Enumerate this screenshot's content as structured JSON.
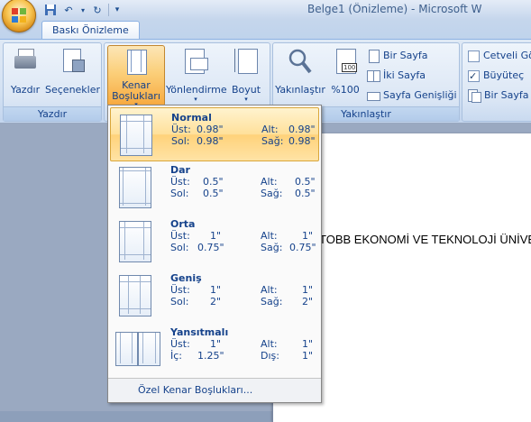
{
  "window": {
    "title": "Belge1 (Önizleme) - Microsoft W"
  },
  "tabs": {
    "active": "Baskı Önizleme"
  },
  "ribbon": {
    "groups": {
      "print": {
        "label": "Yazdır",
        "buttons": [
          "Yazdır",
          "Seçenekler"
        ]
      },
      "page": {
        "buttons": {
          "margins_line1": "Kenar",
          "margins_line2": "Boşlukları",
          "orientation": "Yönlendirme",
          "size": "Boyut"
        }
      },
      "zoom": {
        "label": "Yakınlaştır",
        "zoom": "Yakınlaştır",
        "percent": "%100",
        "one_page": "Bir Sayfa",
        "two_pages": "İki Sayfa",
        "page_width": "Sayfa Genişliği"
      },
      "preview": {
        "ruler": "Cetveli Gö",
        "magnifier": "Büyüteç",
        "shrink": "Bir Sayfa D"
      }
    }
  },
  "document": {
    "text": "TOBB EKONOMİ VE TEKNOLOJİ ÜNİVE"
  },
  "margins_menu": {
    "items": [
      {
        "title": "Normal",
        "labels": [
          "Üst:",
          "Alt:",
          "Sol:",
          "Sağ:"
        ],
        "values": [
          "0.98\"",
          "0.98\"",
          "0.98\"",
          "0.98\""
        ],
        "selected": true
      },
      {
        "title": "Dar",
        "labels": [
          "Üst:",
          "Alt:",
          "Sol:",
          "Sağ:"
        ],
        "values": [
          "0.5\"",
          "0.5\"",
          "0.5\"",
          "0.5\""
        ],
        "selected": false
      },
      {
        "title": "Orta",
        "labels": [
          "Üst:",
          "Alt:",
          "Sol:",
          "Sağ:"
        ],
        "values": [
          "1\"",
          "1\"",
          "0.75\"",
          "0.75\""
        ],
        "selected": false
      },
      {
        "title": "Geniş",
        "labels": [
          "Üst:",
          "Alt:",
          "Sol:",
          "Sağ:"
        ],
        "values": [
          "1\"",
          "1\"",
          "2\"",
          "2\""
        ],
        "selected": false
      },
      {
        "title": "Yansıtmalı",
        "labels": [
          "Üst:",
          "Alt:",
          "İç:",
          "Dış:"
        ],
        "values": [
          "1\"",
          "1\"",
          "1.25\"",
          "1\""
        ],
        "selected": false
      }
    ],
    "footer": "Özel Kenar Boşlukları..."
  }
}
